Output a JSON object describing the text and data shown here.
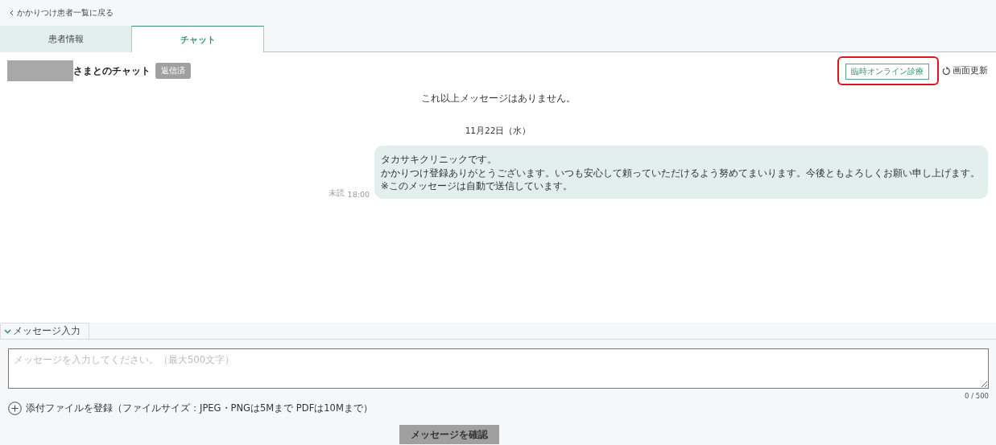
{
  "back_link": {
    "label": "かかりつけ患者一覧に戻る"
  },
  "tabs": [
    {
      "label": "患者情報",
      "selected": false
    },
    {
      "label": "チャット",
      "selected": true
    }
  ],
  "chat_header": {
    "title": "さまとのチャット",
    "status_badge": "返信済",
    "online_button": "臨時オンライン診療",
    "online_button_highlighted": true,
    "refresh": "画面更新"
  },
  "messages_notice": "これ以上メッセージはありません。",
  "date_divider": "11月22日（水）",
  "messages": [
    {
      "status": "未読",
      "time": "18:00",
      "lines": [
        "タカサキクリニックです。",
        "かかりつけ登録ありがとうございます。いつも安心して頼っていただけるよう努めてまいります。今後ともよろしくお願い申し上げます。",
        "※このメッセージは自動で送信しています。"
      ]
    }
  ],
  "composer": {
    "section_label": "メッセージ入力",
    "expanded": true,
    "placeholder": "メッセージを入力してください。（最大500文字）",
    "counter": "0 / 500",
    "attach_label": "添付ファイルを登録（ファイルサイズ：JPEG・PNGは5Mまで PDFは10Mまで）",
    "submit": "メッセージを確認"
  }
}
